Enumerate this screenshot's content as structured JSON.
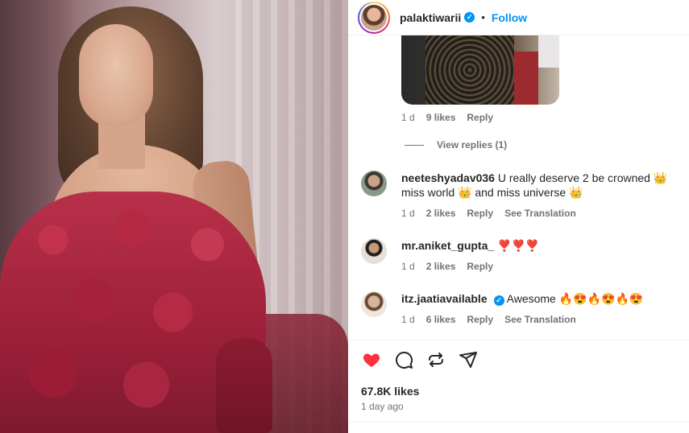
{
  "header": {
    "username": "palaktiwarii",
    "separator": "•",
    "follow_label": "Follow",
    "verified_mark": "✓"
  },
  "first_comment_meta": {
    "age": "1 d",
    "likes": "9 likes",
    "reply": "Reply",
    "view_replies": "View replies (1)"
  },
  "comments": [
    {
      "username": "neeteshyadav036",
      "text": "U really deserve 2 be crowned 👑 miss world 👑 and miss universe 👑",
      "age": "1 d",
      "likes": "2 likes",
      "reply": "Reply",
      "see_translation": "See Translation"
    },
    {
      "username": "mr.aniket_gupta_",
      "text": "❣️❣️❣️",
      "age": "1 d",
      "likes": "2 likes",
      "reply": "Reply"
    },
    {
      "username": "itz.jaatiavailable",
      "verified_mark": "✓",
      "text": "Awesome 🔥😍🔥😍🔥😍",
      "age": "1 d",
      "likes": "6 likes",
      "reply": "Reply",
      "see_translation": "See Translation"
    }
  ],
  "actions": {
    "like_icon": "heart-filled-icon",
    "comment_icon": "comment-icon",
    "repost_icon": "repost-icon",
    "share_icon": "send-icon"
  },
  "post": {
    "likes": "67.8K likes",
    "time": "1 day ago"
  },
  "colors": {
    "accent": "#0095f6",
    "like_red": "#ff3040",
    "secondary_text": "#737373"
  }
}
